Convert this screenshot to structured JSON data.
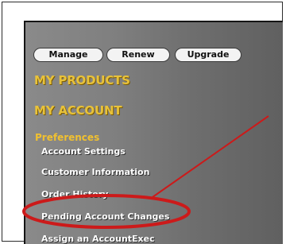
{
  "buttons": {
    "manage_label": "Manage",
    "renew_label": "Renew",
    "upgrade_label": "Upgrade"
  },
  "sections": {
    "my_products_label": "MY PRODUCTS",
    "my_account_label": "MY ACCOUNT",
    "preferences_label": "Preferences"
  },
  "preferences_menu": [
    {
      "label": "Account Settings"
    },
    {
      "label": "Customer Information"
    },
    {
      "label": "Order History"
    },
    {
      "label": "Pending Account Changes"
    },
    {
      "label": "Assign an AccountExec"
    }
  ],
  "colors": {
    "panel_gray": "#7f7f7f",
    "section_gold": "#e8c23a",
    "annotation_red": "#cc1a1a"
  },
  "annotation": {
    "highlighted_item": "Pending Account Changes"
  }
}
